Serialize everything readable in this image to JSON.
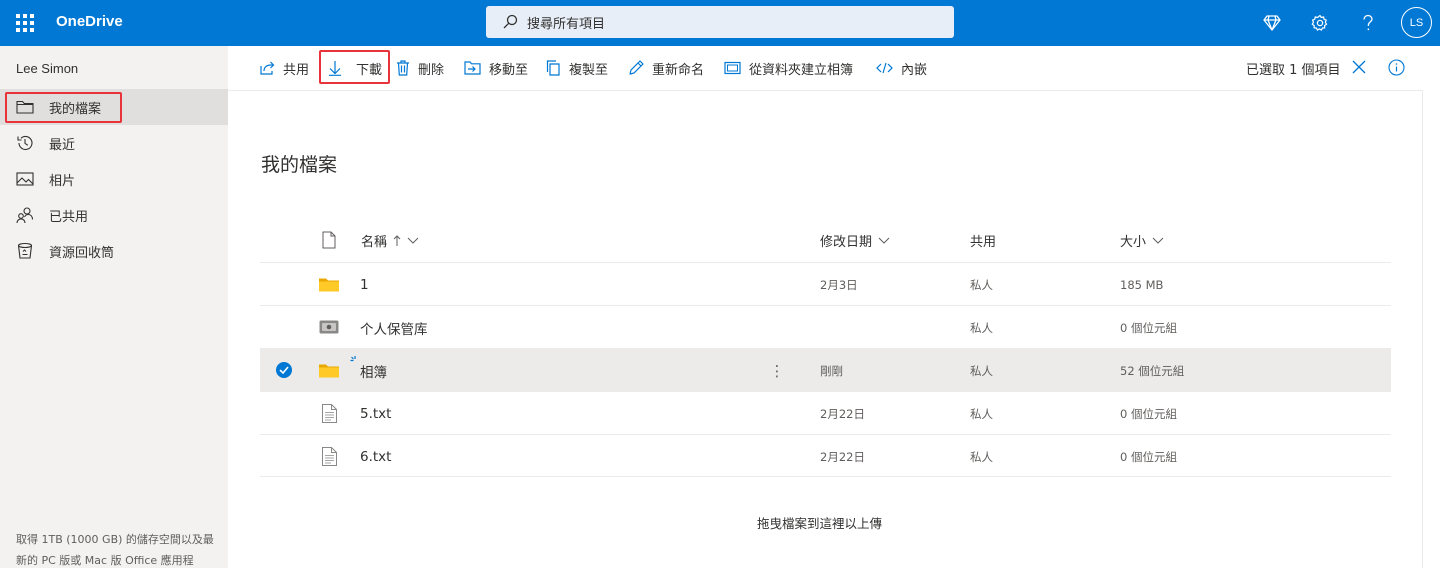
{
  "app": {
    "title": "OneDrive"
  },
  "search": {
    "placeholder": "搜尋所有項目"
  },
  "topbar": {
    "icons": [
      "diamond-icon",
      "gear-icon",
      "help-icon"
    ],
    "avatar_initials": "LS"
  },
  "sidebar": {
    "user_name": "Lee Simon",
    "items": [
      {
        "label": "我的檔案",
        "icon": "folder-icon",
        "active": true
      },
      {
        "label": "最近",
        "icon": "history-icon"
      },
      {
        "label": "相片",
        "icon": "photo-icon"
      },
      {
        "label": "已共用",
        "icon": "people-icon"
      },
      {
        "label": "資源回收筒",
        "icon": "recycle-bin-icon"
      }
    ],
    "promo": "取得 1TB (1000 GB) 的儲存空間以及最新的 PC 版或 Mac 版 Office 應用程"
  },
  "toolbar": {
    "share": "共用",
    "download": "下載",
    "delete": "刪除",
    "move_to": "移動至",
    "copy_to": "複製至",
    "rename": "重新命名",
    "create_album": "從資料夾建立相簿",
    "embed": "內嵌",
    "selection_info": "已選取 1 個項目"
  },
  "main": {
    "title": "我的檔案",
    "columns": {
      "name": "名稱",
      "modified": "修改日期",
      "sharing": "共用",
      "size": "大小"
    },
    "rows": [
      {
        "name": "1",
        "type": "folder",
        "modified": "2月3日",
        "sharing": "私人",
        "size": "185 MB"
      },
      {
        "name": "个人保管库",
        "type": "vault",
        "modified": "",
        "sharing": "私人",
        "size": "0 個位元組"
      },
      {
        "name": "相簿",
        "type": "folder",
        "modified": "剛剛",
        "sharing": "私人",
        "size": "52 個位元組",
        "selected": true
      },
      {
        "name": "5.txt",
        "type": "file",
        "modified": "2月22日",
        "sharing": "私人",
        "size": "0 個位元組"
      },
      {
        "name": "6.txt",
        "type": "file",
        "modified": "2月22日",
        "sharing": "私人",
        "size": "0 個位元組"
      }
    ],
    "drop_hint": "拖曳檔案到這裡以上傳"
  },
  "colors": {
    "brand": "#0078d4",
    "highlight": "#e8333a",
    "folder": "#ffca28"
  }
}
